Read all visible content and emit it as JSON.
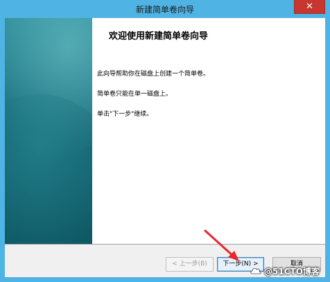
{
  "window": {
    "title": "新建简单卷向导",
    "close_glyph": "✕"
  },
  "wizard": {
    "heading": "欢迎使用新建简单卷向导",
    "paragraphs": [
      "此向导帮助你在磁盘上创建一个简单卷。",
      "简单卷只能在单一磁盘上。",
      "单击\"下一步\"继续。"
    ]
  },
  "buttons": {
    "back": "< 上一步(B)",
    "next": "下一步(N) >",
    "cancel": "取消"
  },
  "annotation": {
    "arrow_color": "#e8262b"
  },
  "watermark": {
    "text": "@51CTO博客"
  },
  "colors": {
    "titlebar": "#4fb3e3",
    "close_button": "#c7372f",
    "banner": "#1a6f7d"
  }
}
